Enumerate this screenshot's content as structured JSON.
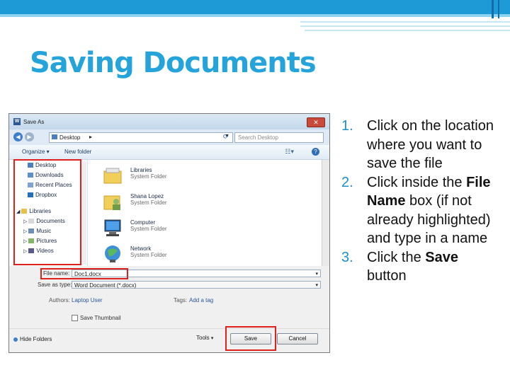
{
  "slide": {
    "title": "Saving Documents",
    "colors": {
      "accent": "#25a4dc",
      "bar": "#1e9ad6",
      "highlight": "#e0201c"
    }
  },
  "dialog": {
    "title": "Save As",
    "address": "Desktop",
    "search_placeholder": "Search Desktop",
    "toolbar": {
      "organize": "Organize ▾",
      "new_folder": "New folder"
    },
    "nav_items": [
      "Desktop",
      "Downloads",
      "Recent Places",
      "Dropbox",
      "Libraries",
      "Documents",
      "Music",
      "Pictures",
      "Videos"
    ],
    "files": [
      {
        "name": "Libraries",
        "type": "System Folder",
        "icon": "libraries-icon"
      },
      {
        "name": "Shana Lopez",
        "type": "System Folder",
        "icon": "user-folder-icon"
      },
      {
        "name": "Computer",
        "type": "System Folder",
        "icon": "computer-icon"
      },
      {
        "name": "Network",
        "type": "System Folder",
        "icon": "network-icon"
      }
    ],
    "file_name_label": "File name:",
    "file_name_value": "Doc1.docx",
    "save_as_type_label": "Save as type:",
    "save_as_type_value": "Word Document (*.docx)",
    "authors_label": "Authors:",
    "authors_value": "Laptop User",
    "tags_label": "Tags:",
    "tags_value": "Add a tag",
    "thumbnail_label": "Save Thumbnail",
    "hide_folders": "Hide Folders",
    "tools": "Tools",
    "save": "Save",
    "cancel": "Cancel"
  },
  "steps": [
    {
      "num": "1.",
      "parts": [
        {
          "text": "Click on the location where you want to save the file",
          "bold": false
        }
      ]
    },
    {
      "num": "2.",
      "parts": [
        {
          "text": "Click inside the ",
          "bold": false
        },
        {
          "text": "File Name",
          "bold": true
        },
        {
          "text": " box (if not already highlighted) and type in a name",
          "bold": false
        }
      ]
    },
    {
      "num": "3.",
      "parts": [
        {
          "text": "Click the ",
          "bold": false
        },
        {
          "text": "Save",
          "bold": true
        },
        {
          "text": " button",
          "bold": false
        }
      ]
    }
  ]
}
